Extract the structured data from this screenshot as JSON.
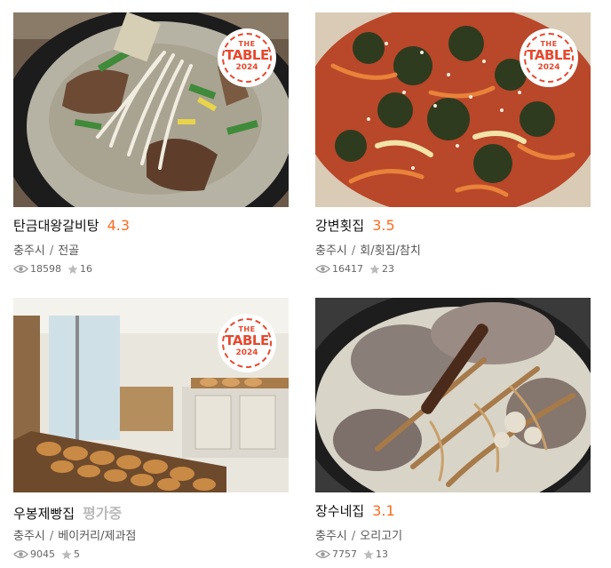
{
  "colors": {
    "rating": "#ff6a1f",
    "pending": "#bbbbbb",
    "badge": "#e6482e"
  },
  "badge": {
    "line1": "THE",
    "line2": "TABLE",
    "line3": "2024"
  },
  "restaurants": [
    {
      "name": "탄금대왕갈비탕",
      "rating": "4.3",
      "city": "충주시",
      "category": "전골",
      "views": "18598",
      "stars": "16",
      "badge": true,
      "image": "galbitang-soup"
    },
    {
      "name": "강변횟집",
      "rating": "3.5",
      "city": "충주시",
      "category": "회/횟집/참치",
      "views": "16417",
      "stars": "23",
      "badge": true,
      "image": "spicy-raw-fish-salad"
    },
    {
      "name": "우봉제빵집",
      "rating": "평가중",
      "city": "충주시",
      "category": "베이커리/제과점",
      "views": "9045",
      "stars": "5",
      "badge": true,
      "image": "bakery-interior"
    },
    {
      "name": "장수네집",
      "rating": "3.1",
      "city": "충주시",
      "category": "오리고기",
      "views": "7757",
      "stars": "13",
      "badge": false,
      "image": "duck-ginseng-soup"
    }
  ]
}
